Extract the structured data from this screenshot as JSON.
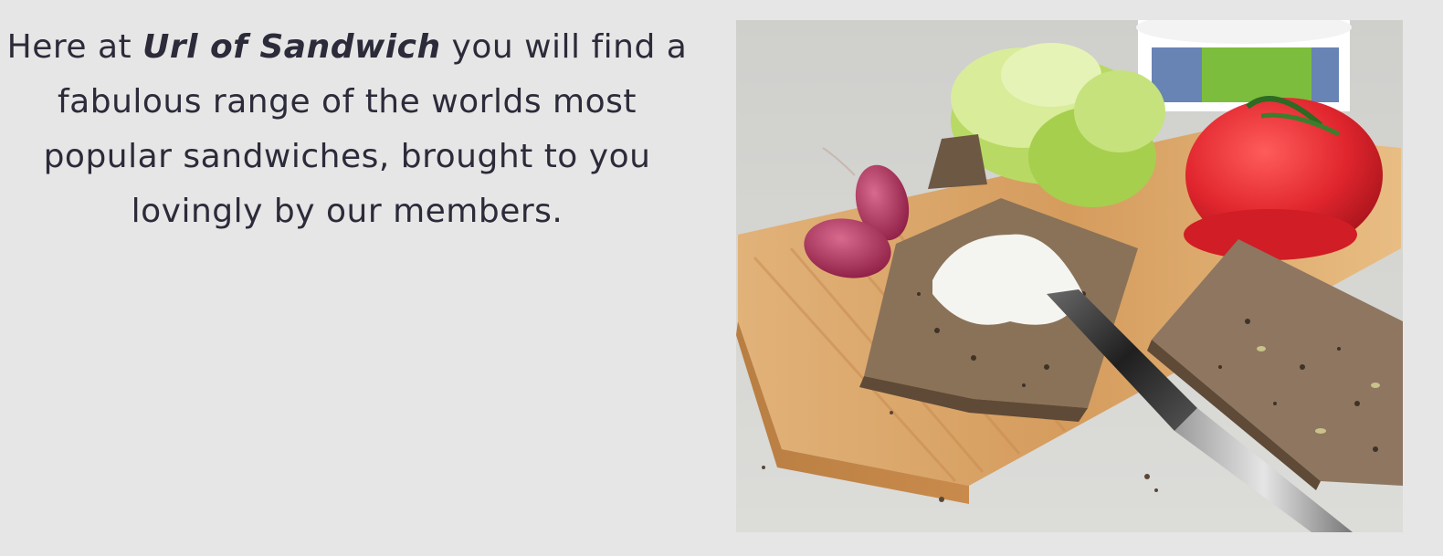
{
  "intro": {
    "text_before": "Here at ",
    "brand_name": "Url of Sandwich",
    "text_after": " you will find a fabulous range of the worlds most popular sandwiches, brought to you lovingly by our members."
  },
  "photo": {
    "subject": "sandwich ingredients on cutting board",
    "colors": {
      "background": "#e6e6e6",
      "tabletop": "#d6d6d3",
      "board": "#d9a66a",
      "bread": "#8a7258",
      "tomato": "#e0252d",
      "lettuce": "#c9e27a",
      "radish": "#b8345a",
      "cream": "#f4f4f0"
    }
  }
}
